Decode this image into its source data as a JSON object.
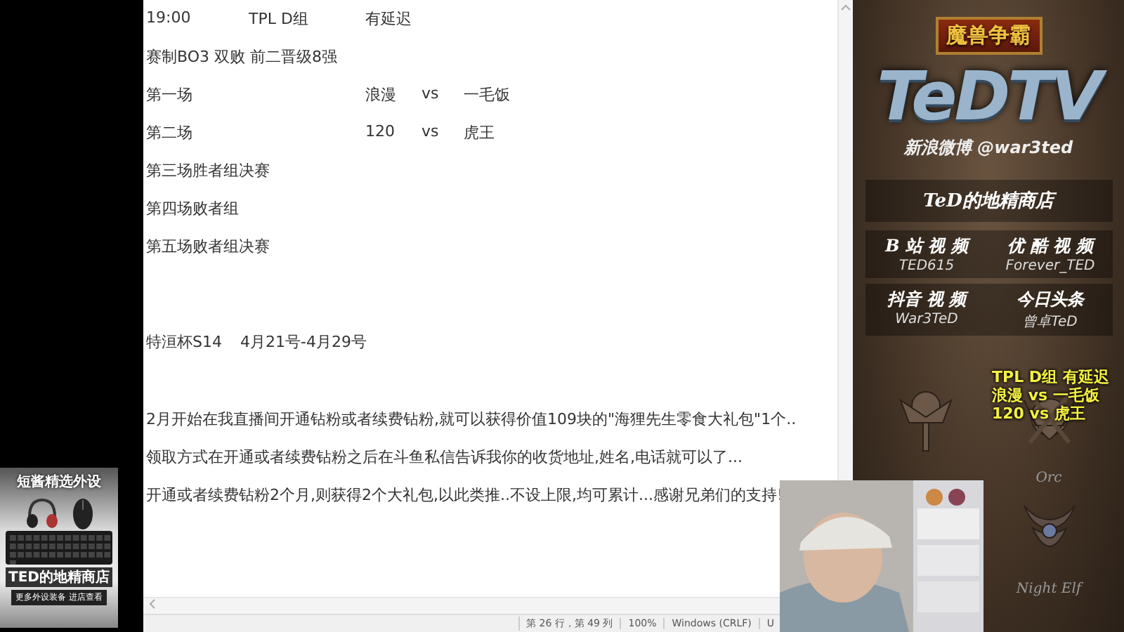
{
  "editor": {
    "blocks": [
      [
        {
          "cells": [
            "19:00",
            "TPL  D组",
            "有延迟"
          ]
        },
        {
          "cells": [
            "赛制BO3  双败  前二晋级8强"
          ]
        },
        {
          "cells": [
            "第一场",
            "",
            "浪漫",
            "vs",
            "一毛饭"
          ]
        },
        {
          "cells": [
            "第二场",
            "",
            "120",
            "vs",
            "虎王"
          ]
        },
        {
          "cells": [
            "第三场胜者组决赛"
          ]
        },
        {
          "cells": [
            "第四场败者组"
          ]
        },
        {
          "cells": [
            "第五场败者组决赛"
          ]
        }
      ],
      [
        {
          "cells": [
            "特洹杯S14",
            "4月21号-4月29号"
          ]
        }
      ],
      [
        {
          "cells": [
            "2月开始在我直播间开通钻粉或者续费钻粉,就可以获得价值109块的\"海狸先生零食大礼包\"1个.."
          ]
        },
        {
          "cells": [
            "领取方式在开通或者续费钻粉之后在斗鱼私信告诉我你的收货地址,姓名,电话就可以了..."
          ]
        },
        {
          "cells": [
            "开通或者续费钻粉2个月,则获得2个大礼包,以此类推..不设上限,均可累计...感谢兄弟们的支持!"
          ]
        }
      ]
    ]
  },
  "status_bar": {
    "position": "第 26 行，第 49 列",
    "zoom": "100%",
    "line_ending": "Windows (CRLF)",
    "encoding": "U"
  },
  "sidebar": {
    "game_logo": "魔兽争霸",
    "channel_logo": "TeDTV",
    "weibo": "新浪微博 @war3ted",
    "shop": "TeD的地精商店",
    "links": [
      {
        "platform": "B 站 视 频",
        "account": "TED615"
      },
      {
        "platform": "优 酷 视 频",
        "account": "Forever_TED"
      },
      {
        "platform": "抖音 视 频",
        "account": "War3TeD"
      },
      {
        "platform": "今日头条",
        "account": "曾卓TeD"
      }
    ],
    "overlay_lines": [
      "TPL D组 有延迟",
      "浪漫 vs 一毛饭",
      "120  vs 虎王"
    ],
    "emblems": [
      {
        "kind": "tusks",
        "label": "Orc"
      },
      {
        "kind": "moon",
        "label": "Night Elf"
      }
    ]
  },
  "ad": {
    "title": "短酱精选外设",
    "shop": "TED的地精商店",
    "note": "更多外设装备 进店查看"
  }
}
